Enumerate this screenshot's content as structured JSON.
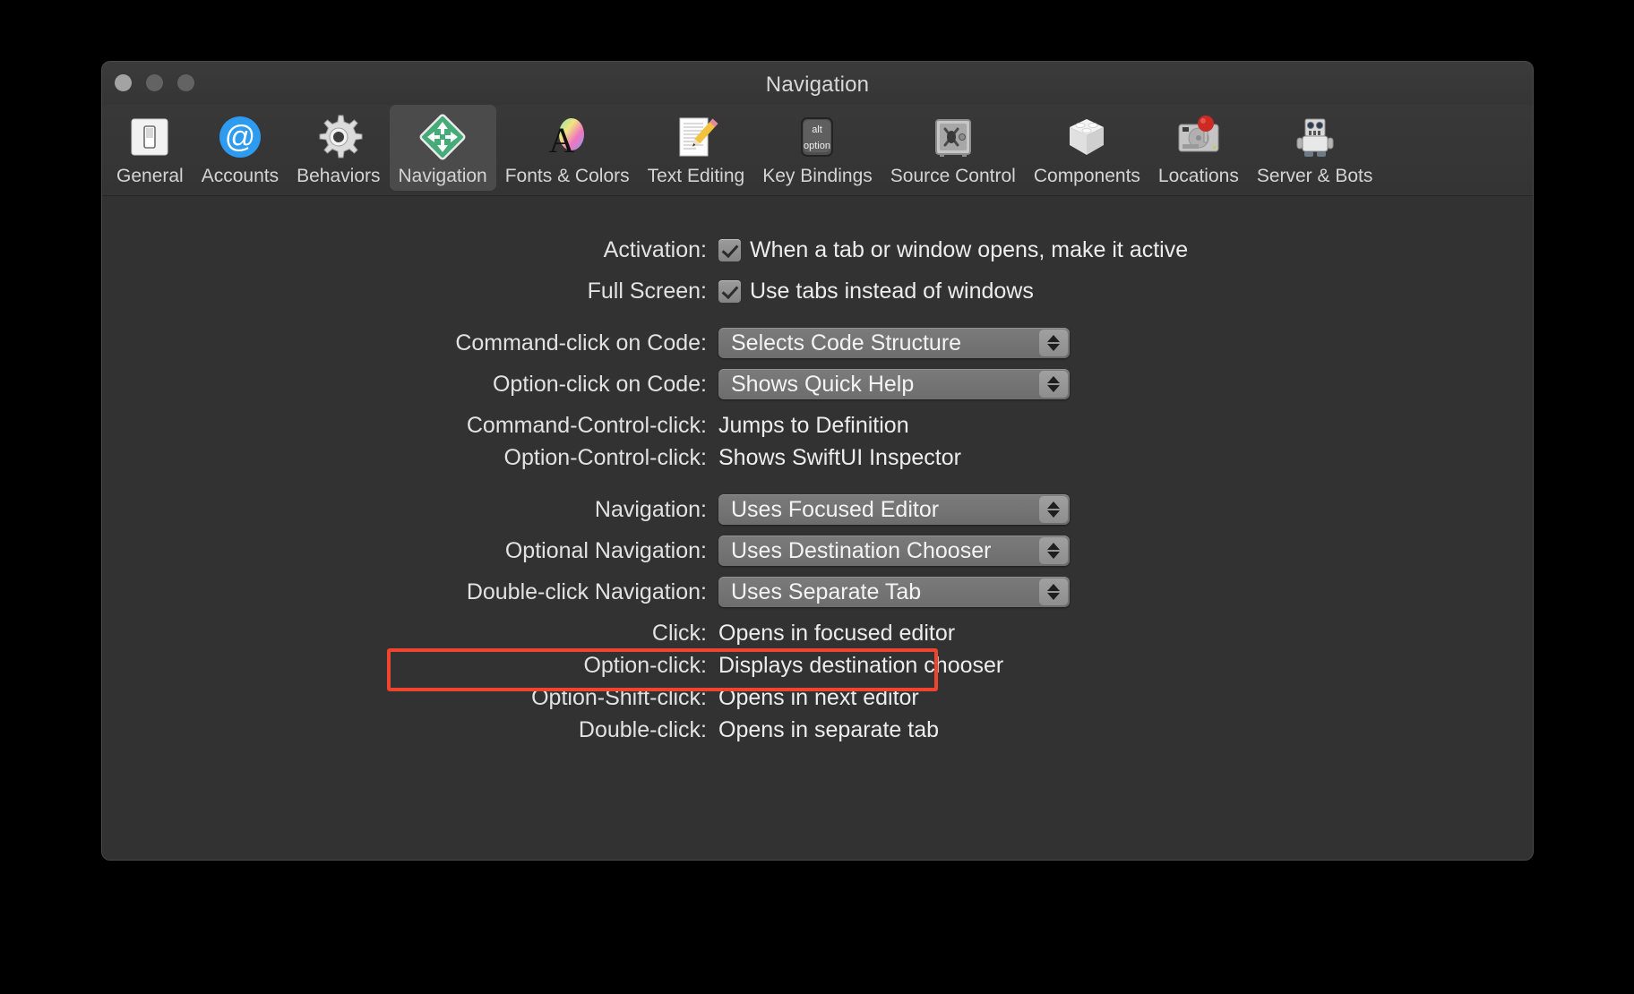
{
  "window": {
    "title": "Navigation",
    "traffic_lights": [
      "close-button",
      "minimize-button",
      "zoom-button"
    ]
  },
  "toolbar": {
    "items": [
      {
        "label": "General",
        "icon": "switch-icon",
        "selected": false
      },
      {
        "label": "Accounts",
        "icon": "at-sign-icon",
        "selected": false
      },
      {
        "label": "Behaviors",
        "icon": "gear-icon",
        "selected": false
      },
      {
        "label": "Navigation",
        "icon": "move-diamond-icon",
        "selected": true
      },
      {
        "label": "Fonts & Colors",
        "icon": "font-color-icon",
        "selected": false
      },
      {
        "label": "Text Editing",
        "icon": "document-pencil-icon",
        "selected": false
      },
      {
        "label": "Key Bindings",
        "icon": "alt-option-key-icon",
        "selected": false
      },
      {
        "label": "Source Control",
        "icon": "safe-icon",
        "selected": false
      },
      {
        "label": "Components",
        "icon": "lego-brick-icon",
        "selected": false
      },
      {
        "label": "Locations",
        "icon": "hard-drive-pin-icon",
        "selected": false
      },
      {
        "label": "Server & Bots",
        "icon": "robot-icon",
        "selected": false
      }
    ]
  },
  "main": {
    "checkbox_rows": [
      {
        "label": "Activation:",
        "text": "When a tab or window opens, make it active",
        "checked": true
      },
      {
        "label": "Full Screen:",
        "text": "Use tabs instead of windows",
        "checked": true
      }
    ],
    "popup_rows": [
      {
        "label": "Command-click on Code:",
        "value": "Selects Code Structure",
        "highlighted": false
      },
      {
        "label": "Option-click on Code:",
        "value": "Shows Quick Help",
        "highlighted": false
      }
    ],
    "static_rows_top": [
      {
        "label": "Command-Control-click:",
        "value": "Jumps to Definition"
      },
      {
        "label": "Option-Control-click:",
        "value": "Shows SwiftUI Inspector"
      }
    ],
    "nav_popup_rows": [
      {
        "label": "Navigation:",
        "value": "Uses Focused Editor",
        "highlighted": false
      },
      {
        "label": "Optional Navigation:",
        "value": "Uses Destination Chooser",
        "highlighted": true
      },
      {
        "label": "Double-click Navigation:",
        "value": "Uses Separate Tab",
        "highlighted": false
      }
    ],
    "static_rows_bottom": [
      {
        "label": "Click:",
        "value": "Opens in focused editor"
      },
      {
        "label": "Option-click:",
        "value": "Displays destination chooser"
      },
      {
        "label": "Option-Shift-click:",
        "value": "Opens in next editor"
      },
      {
        "label": "Double-click:",
        "value": "Opens in separate tab"
      }
    ]
  },
  "colors": {
    "highlight": "#f0442e",
    "window_bg": "#323232",
    "toolbar_bg": "#373737",
    "selected_tab_bg": "#4b4b4b",
    "text": "#ededed",
    "popup_bg": "#747474"
  }
}
